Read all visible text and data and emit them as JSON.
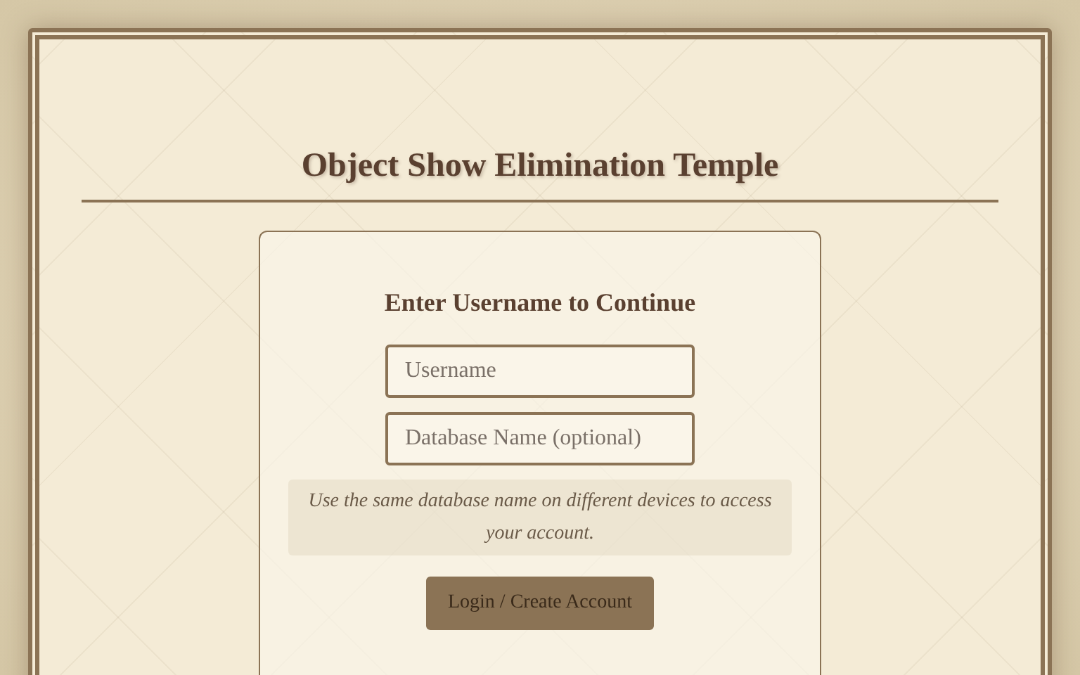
{
  "header": {
    "title": "Object Show Elimination Temple"
  },
  "login_card": {
    "heading": "Enter Username to Continue",
    "fields": [
      {
        "placeholder": "Username"
      },
      {
        "placeholder": "Database Name (optional)"
      }
    ],
    "hint": "Use the same database name on different devices to access your account.",
    "button": "Login / Create Account"
  }
}
